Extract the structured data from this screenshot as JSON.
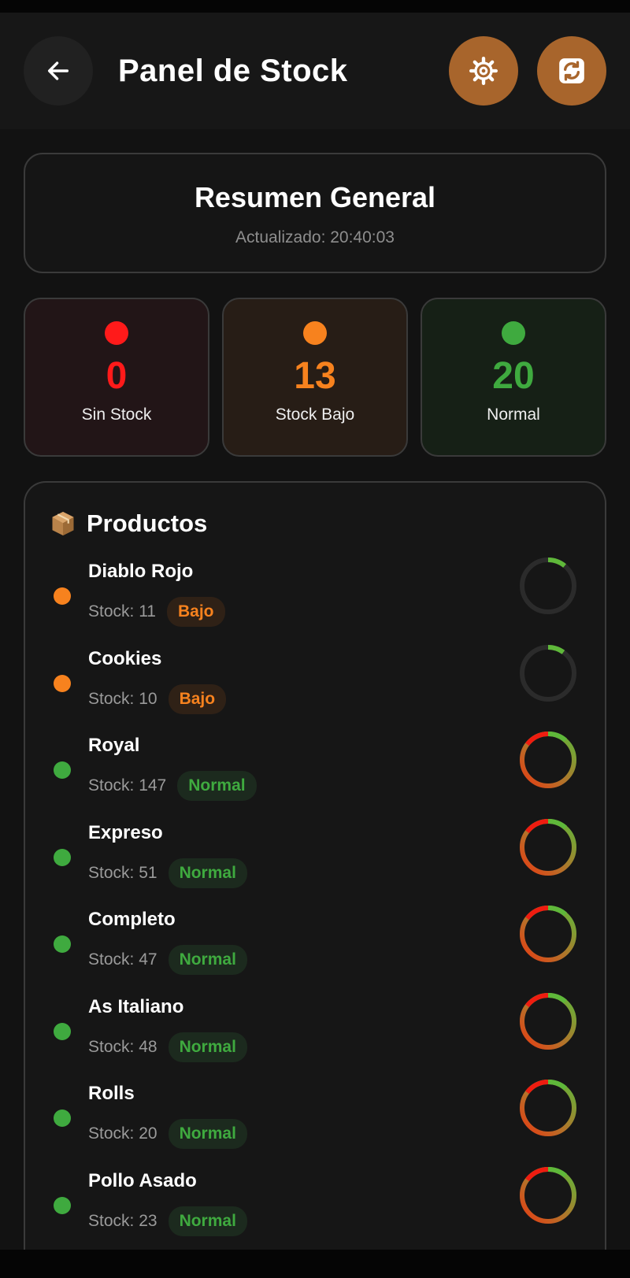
{
  "header": {
    "title": "Panel de Stock"
  },
  "summary": {
    "title": "Resumen General",
    "updated": "Actualizado: 20:40:03"
  },
  "stats": [
    {
      "value": "0",
      "label": "Sin Stock",
      "color": "#ff1a1a"
    },
    {
      "value": "13",
      "label": "Stock Bajo",
      "color": "#f7821e"
    },
    {
      "value": "20",
      "label": "Normal",
      "color": "#3faa3f"
    }
  ],
  "products": {
    "title": "Productos",
    "items": [
      {
        "name": "Diablo Rojo",
        "stock": "Stock: 11",
        "status": "Bajo",
        "level": "low",
        "fill": 0.11
      },
      {
        "name": "Cookies",
        "stock": "Stock: 10",
        "status": "Bajo",
        "level": "low",
        "fill": 0.1
      },
      {
        "name": "Royal",
        "stock": "Stock: 147",
        "status": "Normal",
        "level": "ok",
        "fill": 1.0
      },
      {
        "name": "Expreso",
        "stock": "Stock: 51",
        "status": "Normal",
        "level": "ok",
        "fill": 1.0
      },
      {
        "name": "Completo",
        "stock": "Stock: 47",
        "status": "Normal",
        "level": "ok",
        "fill": 1.0
      },
      {
        "name": "As Italiano",
        "stock": "Stock: 48",
        "status": "Normal",
        "level": "ok",
        "fill": 1.0
      },
      {
        "name": "Rolls",
        "stock": "Stock: 20",
        "status": "Normal",
        "level": "ok",
        "fill": 1.0
      },
      {
        "name": "Pollo Asado",
        "stock": "Stock: 23",
        "status": "Normal",
        "level": "ok",
        "fill": 1.0
      }
    ]
  },
  "colors": {
    "accent": "#a8652c",
    "low": "#f7821e",
    "ok": "#3faa3f",
    "out": "#ff1a1a"
  }
}
